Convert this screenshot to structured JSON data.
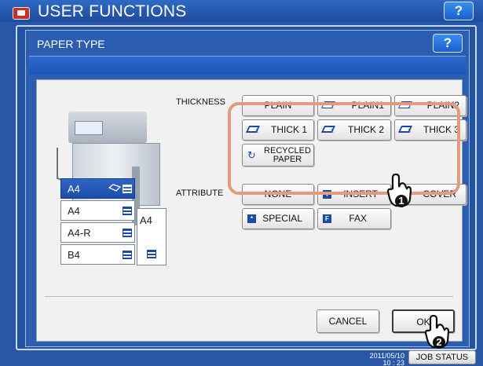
{
  "app": {
    "title": "USER FUNCTIONS",
    "help": "?"
  },
  "dialog": {
    "title": "PAPER TYPE",
    "help": "?"
  },
  "drawers": [
    {
      "label": "A4",
      "selected": true
    },
    {
      "label": "A4",
      "selected": false
    },
    {
      "label": "A4-R",
      "selected": false
    },
    {
      "label": "B4",
      "selected": false
    }
  ],
  "lcf": {
    "label": "A4"
  },
  "thickness": {
    "label": "THICKNESS",
    "options": [
      {
        "label": "PLAIN",
        "icon": "none",
        "sub": ""
      },
      {
        "label": "PLAIN1",
        "icon": "paper-sheet-icon",
        "sub": "1"
      },
      {
        "label": "PLAIN2",
        "icon": "paper-sheet-icon",
        "sub": "2"
      },
      {
        "label": "THICK 1",
        "icon": "thick-sheet-icon",
        "sub": "1"
      },
      {
        "label": "THICK 2",
        "icon": "thick-sheet-icon",
        "sub": "2"
      },
      {
        "label": "THICK 3",
        "icon": "thick-sheet-icon",
        "sub": "3"
      },
      {
        "label_line1": "RECYCLED",
        "label_line2": "PAPER",
        "icon": "recycle-icon"
      }
    ]
  },
  "attribute": {
    "label": "ATTRIBUTE",
    "options": [
      {
        "label": "NONE",
        "icon": "none"
      },
      {
        "label": "INSERT",
        "icon": "insert-icon",
        "glyph": "I"
      },
      {
        "label": "COVER",
        "icon": "cover-icon"
      },
      {
        "label": "SPECIAL",
        "icon": "special-icon",
        "glyph": "*"
      },
      {
        "label": "FAX",
        "icon": "fax-icon",
        "glyph": "F"
      }
    ]
  },
  "actions": {
    "cancel": "CANCEL",
    "ok": "OK"
  },
  "status": {
    "date": "2011/05/10",
    "time": "10 : 23",
    "job_status": "JOB STATUS"
  },
  "callouts": [
    "1",
    "2"
  ],
  "colors": {
    "accent": "#2a56a8",
    "highlight": "#e39a7f",
    "icon": "#1b49a5"
  }
}
